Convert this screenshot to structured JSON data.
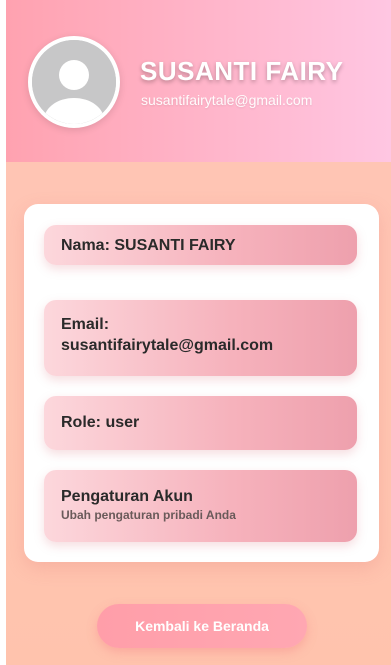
{
  "profile": {
    "name": "SUSANTI FAIRY",
    "email": "susantifairytale@gmail.com",
    "avatar_icon": "user-avatar-placeholder-icon"
  },
  "details": {
    "name_label": "Nama: SUSANTI FAIRY",
    "email_label": "Email:",
    "email_value": "susantifairytale@gmail.com",
    "role_label": "Role: user",
    "settings_title": "Pengaturan Akun",
    "settings_subtitle": "Ubah pengaturan pribadi Anda"
  },
  "actions": {
    "back_label": "Kembali ke Beranda"
  },
  "colors": {
    "header_start": "#ffa2b0",
    "header_end": "#ffc6e2",
    "background": "#ffc4b6",
    "card": "#ffffff",
    "item_start": "#fcd7dc",
    "item_end": "#eea0ad",
    "button": "#ff9ea9"
  }
}
